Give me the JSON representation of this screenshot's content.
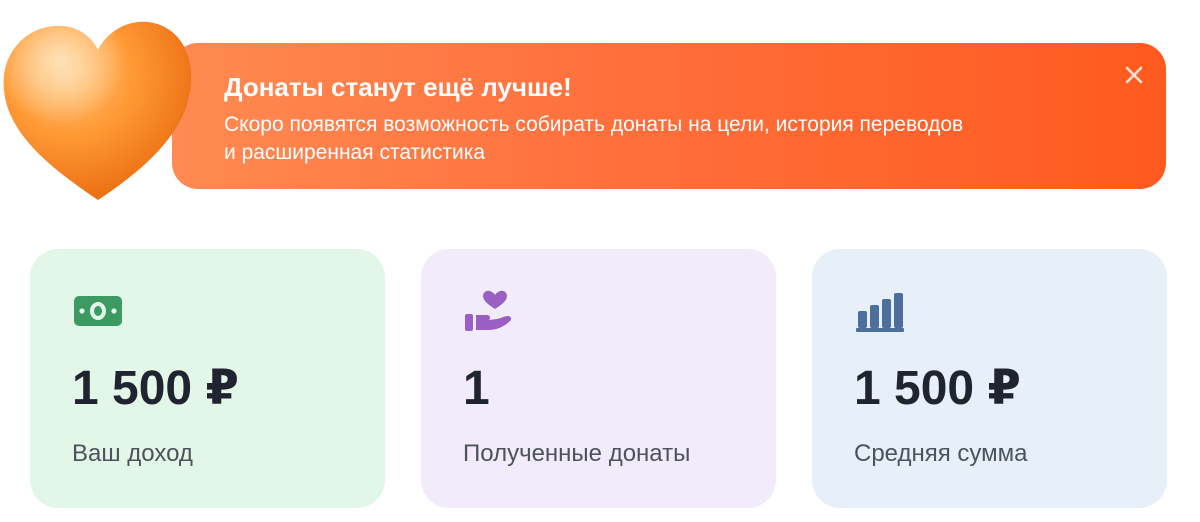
{
  "banner": {
    "title": "Донаты станут ещё лучше!",
    "text_line1": "Скоро появятся возможность собирать донаты на цели, история переводов",
    "text_line2": "и расширенная статистика",
    "close_icon": "close-icon",
    "heart_icon": "heart-icon",
    "colors": {
      "start": "#ff8a52",
      "end": "#ff5a1e",
      "heart": "#ff8a2a"
    }
  },
  "stats": [
    {
      "icon": "money-icon",
      "value": "1 500 ₽",
      "label": "Ваш доход",
      "background": "#e3f7e8",
      "icon_color": "#3e9a63"
    },
    {
      "icon": "hand-heart-icon",
      "value": "1",
      "label": "Полученные донаты",
      "background": "#f2ebfa",
      "icon_color": "#9a5fc2"
    },
    {
      "icon": "bar-chart-icon",
      "value": "1 500 ₽",
      "label": "Средняя сумма",
      "background": "#e7eff9",
      "icon_color": "#4c6f9c"
    }
  ]
}
